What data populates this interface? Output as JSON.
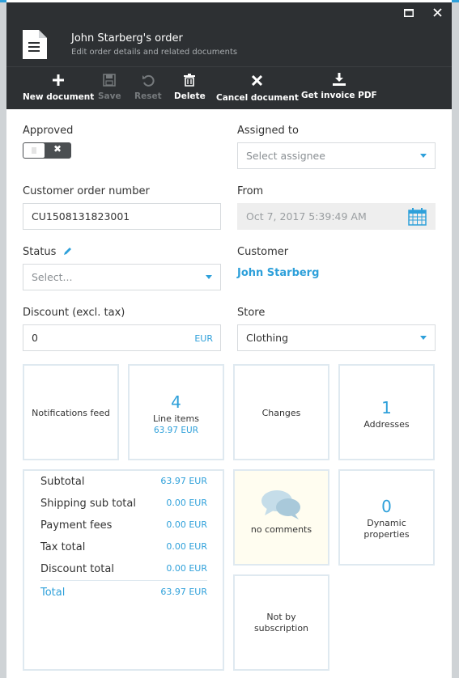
{
  "window": {
    "maximize_icon": "maximize-icon",
    "close_icon": "close-icon"
  },
  "header": {
    "title": "John Starberg's order",
    "subtitle": "Edit order details and related documents",
    "icon": "document-icon"
  },
  "toolbar": {
    "new_document": "New document",
    "save": "Save",
    "reset": "Reset",
    "delete": "Delete",
    "cancel_document": "Cancel document",
    "get_invoice_pdf": "Get invoice PDF"
  },
  "form": {
    "approved_label": "Approved",
    "approved": false,
    "assigned_to_label": "Assigned to",
    "assigned_to_placeholder": "Select assignee",
    "customer_order_number_label": "Customer order number",
    "customer_order_number": "CU1508131823001",
    "from_label": "From",
    "from_value": "Oct 7, 2017 5:39:49 AM",
    "status_label": "Status",
    "status_placeholder": "Select...",
    "customer_label": "Customer",
    "customer_name": "John Starberg",
    "discount_label": "Discount (excl. tax)",
    "discount_value": "0",
    "discount_currency": "EUR",
    "store_label": "Store",
    "store_value": "Clothing"
  },
  "tiles": {
    "notifications": "Notifications feed",
    "line_items_count": "4",
    "line_items_label": "Line items",
    "line_items_total": "63.97 EUR",
    "changes": "Changes",
    "addresses_count": "1",
    "addresses_label": "Addresses",
    "comments_label": "no comments",
    "dynamic_count": "0",
    "dynamic_label_1": "Dynamic",
    "dynamic_label_2": "properties",
    "subscription_1": "Not by",
    "subscription_2": "subscription"
  },
  "totals": [
    {
      "label": "Subtotal",
      "value": "63.97 EUR"
    },
    {
      "label": "Shipping sub total",
      "value": "0.00 EUR"
    },
    {
      "label": "Payment fees",
      "value": "0.00 EUR"
    },
    {
      "label": "Tax total",
      "value": "0.00 EUR"
    },
    {
      "label": "Discount total",
      "value": "0.00 EUR"
    },
    {
      "label": "Total",
      "value": "63.97 EUR"
    }
  ],
  "colors": {
    "accent": "#2ea0da",
    "dark": "#2d3033",
    "comments_bg": "#fffdf0"
  }
}
